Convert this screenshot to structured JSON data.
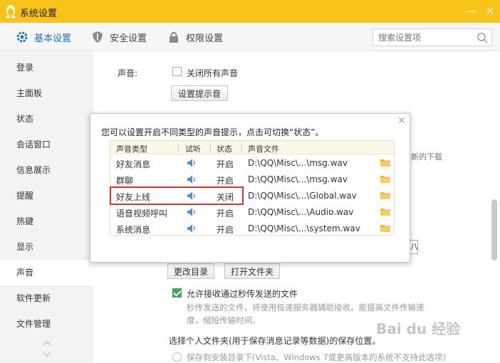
{
  "window": {
    "title": "系统设置",
    "minimize_glyph": "—",
    "close_glyph": "✕",
    "accent": "#f9c31a"
  },
  "tabs": [
    {
      "label": "基本设置",
      "icon": "gear-icon",
      "active": true
    },
    {
      "label": "安全设置",
      "icon": "shield-icon",
      "active": false
    },
    {
      "label": "权限设置",
      "icon": "lock-icon",
      "active": false
    }
  ],
  "search": {
    "placeholder": "搜索设置项",
    "icon": "search-icon"
  },
  "sidebar": {
    "items": [
      {
        "label": "登录"
      },
      {
        "label": "主面板"
      },
      {
        "label": "状态"
      },
      {
        "label": "会话窗口"
      },
      {
        "label": "信息展示"
      },
      {
        "label": "提醒"
      },
      {
        "label": "热键"
      },
      {
        "label": "显示"
      },
      {
        "label": "声音",
        "active": true
      },
      {
        "label": "软件更新"
      },
      {
        "label": "文件管理"
      }
    ]
  },
  "main": {
    "sound_label": "声音:",
    "mute_all_label": "关闭所有声音",
    "set_sound_button": "设置提示音",
    "partial_text_right": "新的下载",
    "partial_text_right2": "八",
    "change_dir_button": "更改目录",
    "open_folder_button": "打开文件夹",
    "allow_receive_label": "允许接收通过秒传发送的文件",
    "allow_receive_desc_line1": "秒传发送的文件，将使用极速服务器辅助接收。能提高文件传输速",
    "allow_receive_desc_line2": "度，缩短传输时间。",
    "personal_folder_title": "选择个人文件夹(用于保存消息记录等数据)的保存位置。",
    "save_install_dir_label": "保存到安装目录下(Vista、Windows 7或更高版本的系统不支持此选项)"
  },
  "popup": {
    "message": "您可以设置开启不同类型的声音提示，点击可切换“状态”。",
    "close_glyph": "✕",
    "columns": [
      "声音类型",
      "试听",
      "状态",
      "声音文件"
    ],
    "rows": [
      {
        "type": "好友消息",
        "status": "开启",
        "file": "D:\\QQ\\Misc\\...\\msg.wav"
      },
      {
        "type": "群聊",
        "status": "开启",
        "file": "D:\\QQ\\Misc\\...\\msg.wav"
      },
      {
        "type": "好友上线",
        "status": "关闭",
        "file": "D:\\QQ\\Misc\\...\\Global.wav"
      },
      {
        "type": "语音视频呼叫",
        "status": "开启",
        "file": "D:\\QQ\\Misc\\...\\Audio.wav"
      },
      {
        "type": "系统消息",
        "status": "开启",
        "file": "D:\\QQ\\Misc\\...\\system.wav"
      }
    ],
    "highlight_color": "#e0302a"
  },
  "watermark": {
    "text": "Bai du 经验"
  }
}
